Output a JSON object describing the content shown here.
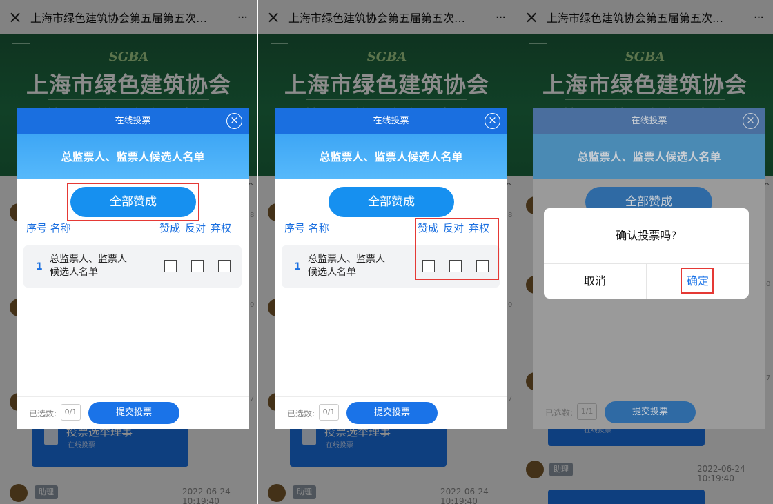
{
  "colors": {
    "primary": "#1a6fe0",
    "highlight": "#e53935",
    "banner_green": "#1f7547"
  },
  "topbar": {
    "close_icon": "×",
    "title": "上海市绿色建筑协会第五届第五次…",
    "more_icon": "···"
  },
  "banner": {
    "logo_text": "SGBA",
    "title": "上海市绿色建筑协会",
    "subtitle": "第五届第五次会员大会"
  },
  "modal": {
    "header": "在线投票",
    "close_icon": "⊗",
    "banner": "总监票人、监票人候选人名单",
    "approve_all": "全部赞成",
    "col_index_name": "序号 名称",
    "col_approve": "赞成",
    "col_oppose": "反对",
    "col_abstain": "弃权",
    "row": {
      "num": "1",
      "name": "总监票人、监票人候选人名单"
    },
    "selected_label": "已选数:",
    "selected_count_before": "0/1",
    "selected_count_after": "1/1",
    "submit": "提交投票"
  },
  "confirm": {
    "text": "确认投票吗?",
    "cancel": "取消",
    "ok": "确定"
  },
  "chat": {
    "card_title": "投票选举理事",
    "card_sub": "在线投票",
    "badge": "助理",
    "timestamp": "2022-06-24 10:19:40",
    "side_nums": [
      "8",
      "0",
      "7"
    ]
  }
}
